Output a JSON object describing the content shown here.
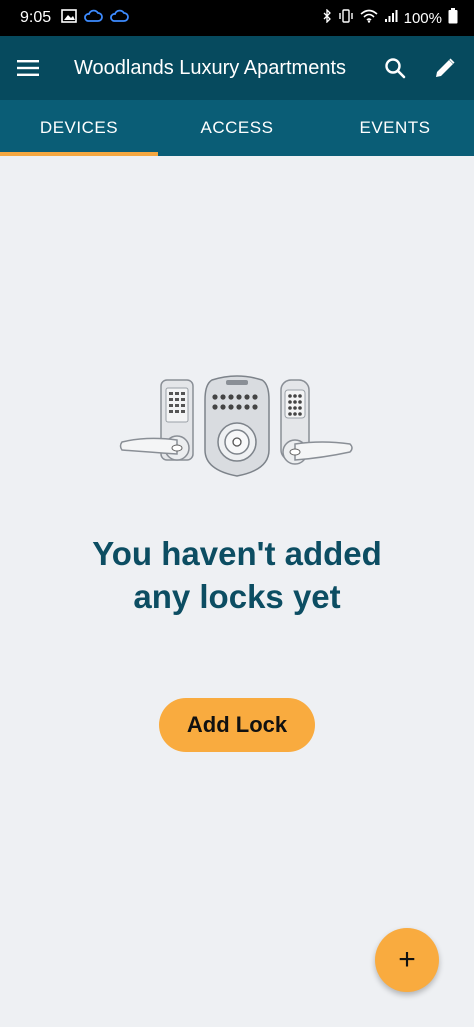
{
  "status_bar": {
    "time": "9:05",
    "battery": "100%"
  },
  "app_bar": {
    "title": "Woodlands Luxury Apartments"
  },
  "tabs": [
    {
      "label": "DEVICES",
      "active": true
    },
    {
      "label": "ACCESS",
      "active": false
    },
    {
      "label": "EVENTS",
      "active": false
    }
  ],
  "empty_state": {
    "title_line1": "You haven't added",
    "title_line2": "any locks yet",
    "button_label": "Add Lock"
  },
  "fab": {
    "label": "+"
  },
  "colors": {
    "app_bar": "#064a5e",
    "tab_bar": "#0a5d76",
    "accent": "#f9ab3f",
    "title_text": "#0c4d62",
    "background": "#eef0f3"
  },
  "icons": {
    "menu": "menu-icon",
    "search": "search-icon",
    "edit": "pencil-icon",
    "add": "plus-icon"
  }
}
